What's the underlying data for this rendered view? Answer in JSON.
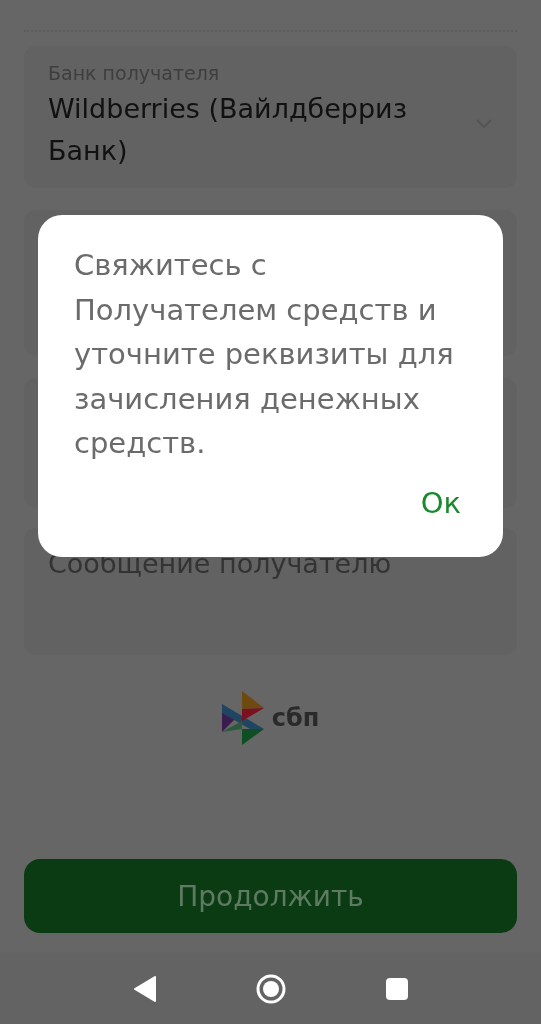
{
  "bank_field": {
    "label": "Банк получателя",
    "value": "Wildberries (Вайлдберриз Банк)"
  },
  "message_field": {
    "placeholder": "Сообщение получателю"
  },
  "sbp_logo": {
    "text": "сбп"
  },
  "continue_button": {
    "label": "Продолжить"
  },
  "dialog": {
    "message": "Свяжитесь с Получателем средств и уточните реквизиты для зачисления денежных средств.",
    "button": "Ок"
  }
}
